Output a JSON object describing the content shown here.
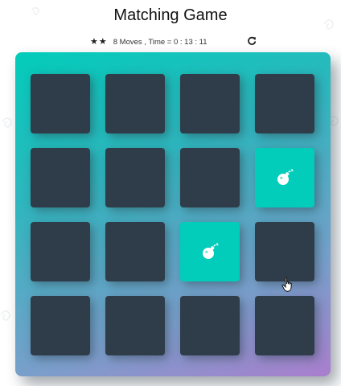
{
  "page": {
    "title": "Matching Game"
  },
  "score_panel": {
    "stars_shown": 2,
    "star_glyph": "★",
    "moves_time_text": "8 Moves , Time = 0 : 13 : 11",
    "restart_icon": "restart-icon"
  },
  "colors": {
    "card_back": "#2e3d49",
    "card_open": "#02ccba",
    "deck_gradient_start": "#02ccba",
    "deck_gradient_end": "#aa7ecd"
  },
  "deck": {
    "rows": 4,
    "columns": 4,
    "cards": [
      {
        "state": "closed",
        "icon": ""
      },
      {
        "state": "closed",
        "icon": ""
      },
      {
        "state": "closed",
        "icon": ""
      },
      {
        "state": "closed",
        "icon": ""
      },
      {
        "state": "closed",
        "icon": ""
      },
      {
        "state": "closed",
        "icon": ""
      },
      {
        "state": "closed",
        "icon": ""
      },
      {
        "state": "open",
        "icon": "bomb-icon"
      },
      {
        "state": "closed",
        "icon": ""
      },
      {
        "state": "closed",
        "icon": ""
      },
      {
        "state": "open",
        "icon": "bomb-icon"
      },
      {
        "state": "closed",
        "icon": ""
      },
      {
        "state": "closed",
        "icon": ""
      },
      {
        "state": "closed",
        "icon": ""
      },
      {
        "state": "closed",
        "icon": ""
      },
      {
        "state": "closed",
        "icon": ""
      }
    ]
  },
  "cursor": {
    "icon": "hand-pointer-icon"
  }
}
